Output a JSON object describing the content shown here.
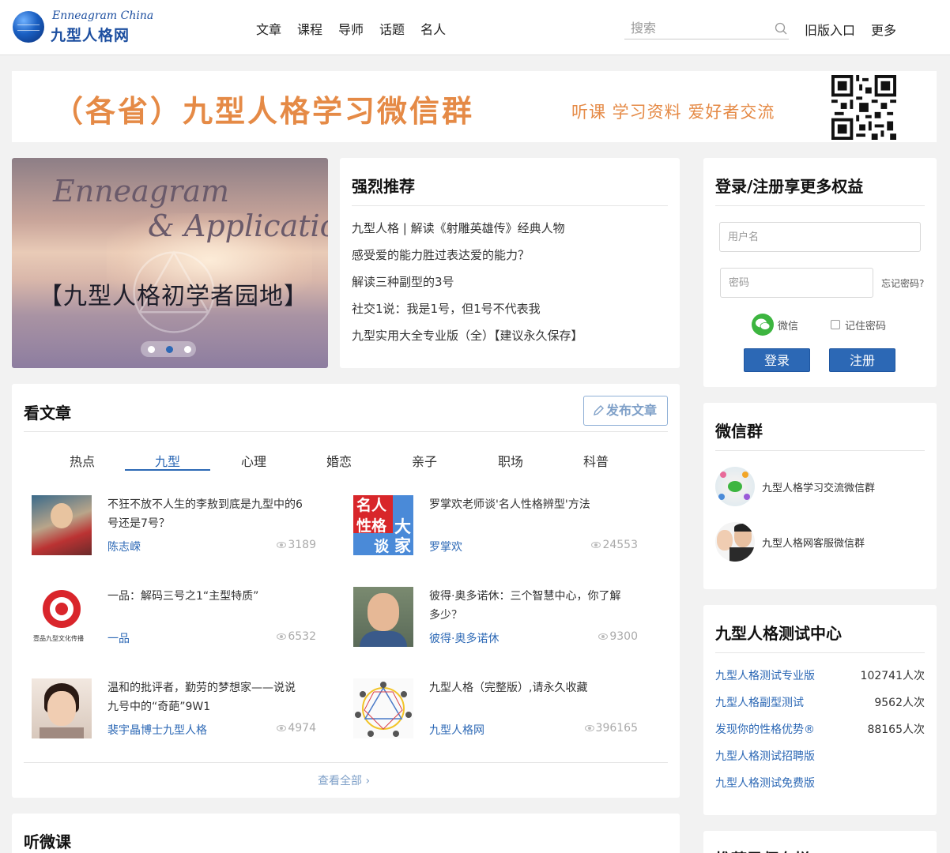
{
  "header": {
    "logo_en": "Enneagram China",
    "logo_cn": "九型人格网",
    "nav": [
      "文章",
      "课程",
      "导师",
      "话题",
      "名人"
    ],
    "search_placeholder": "搜索",
    "old_entry": "旧版入口",
    "more": "更多"
  },
  "banner": {
    "title": "（各省）九型人格学习微信群",
    "subtitle": "听课  学习资料  爱好者交流"
  },
  "slider": {
    "line1": "Enneagram",
    "line2": "& Application",
    "caption": "【九型人格初学者园地】",
    "active_dot": 2,
    "dot_count": 3
  },
  "recommend": {
    "title": "强烈推荐",
    "items": [
      "九型人格 | 解读《射雕英雄传》经典人物",
      "感受爱的能力胜过表达爱的能力？",
      "解读三种副型的3号",
      "社交1说：我是1号，但1号不代表我",
      "九型实用大全专业版（全）【建议永久保存】"
    ]
  },
  "login": {
    "title": "登录/注册享更多权益",
    "username_placeholder": "用户名",
    "password_placeholder": "密码",
    "forgot": "忘记密码?",
    "wechat": "微信",
    "remember": "记住密码",
    "login_btn": "登录",
    "register_btn": "注册"
  },
  "articles": {
    "title": "看文章",
    "publish_btn": "发布文章",
    "tabs": [
      "热点",
      "九型",
      "心理",
      "婚恋",
      "亲子",
      "职场",
      "科普"
    ],
    "active_tab": 1,
    "items": [
      {
        "title": "不狂不放不人生的李敖到底是九型中的6号还是7号？",
        "author": "陈志嵘",
        "views": "3189"
      },
      {
        "title": "罗掌欢老师谈'名人性格辨型'方法",
        "author": "罗掌欢",
        "views": "24553"
      },
      {
        "title": "一品：解码三号之1“主型特质”",
        "author": "一品",
        "views": "6532"
      },
      {
        "title": "彼得·奥多诺休：三个智慧中心，你了解多少？",
        "author": "彼得·奥多诺休",
        "views": "9300"
      },
      {
        "title": "温和的批评者，勤劳的梦想家——说说九号中的“奇葩”9W1",
        "author": "裴宇晶博士九型人格",
        "views": "4974"
      },
      {
        "title": "九型人格（完整版）,请永久收藏",
        "author": "九型人格网",
        "views": "396165"
      }
    ],
    "thumb_texts": {
      "celebrity": [
        "名人",
        "大",
        "性格",
        "家",
        "谈"
      ],
      "yipin_brand": "壹品九型文化传播"
    },
    "view_all": "查看全部"
  },
  "wechat_groups": {
    "title": "微信群",
    "items": [
      "九型人格学习交流微信群",
      "九型人格网客服微信群"
    ]
  },
  "test_center": {
    "title": "九型人格测试中心",
    "items": [
      {
        "name": "九型人格测试专业版",
        "count": "102741人次"
      },
      {
        "name": "九型人格副型测试",
        "count": "9562人次"
      },
      {
        "name": "发现你的性格优势®",
        "count": "88165人次"
      },
      {
        "name": "九型人格测试招聘版",
        "count": ""
      },
      {
        "name": "九型人格测试免费版",
        "count": ""
      }
    ]
  },
  "listen": {
    "title": "听微课"
  },
  "teacher_rank": {
    "title": "推荐导师专栏"
  },
  "colors": {
    "accent": "#2c68b5",
    "banner_orange": "#e58a46",
    "wechat_green": "#3db540"
  }
}
